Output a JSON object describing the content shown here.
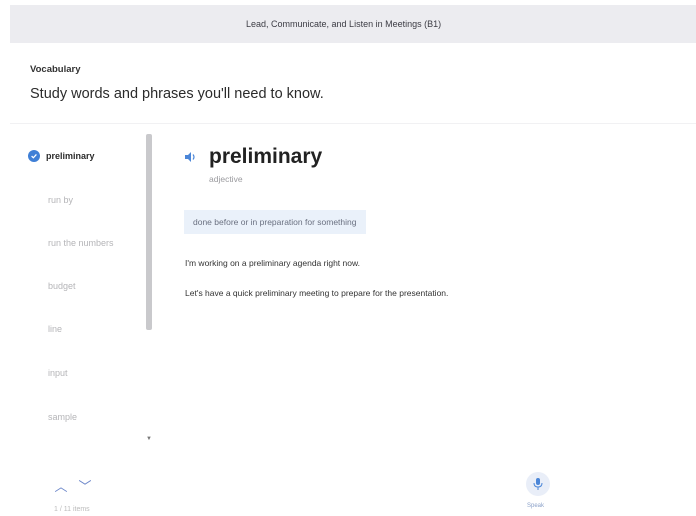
{
  "header": {
    "course_title": "Lead, Communicate, and Listen in Meetings (B1)"
  },
  "section": {
    "label": "Vocabulary",
    "subtitle": "Study words and phrases you'll need to know."
  },
  "word_list": [
    {
      "label": "preliminary",
      "active": true
    },
    {
      "label": "run by"
    },
    {
      "label": "run the numbers"
    },
    {
      "label": "budget"
    },
    {
      "label": "line"
    },
    {
      "label": "input"
    },
    {
      "label": "sample"
    }
  ],
  "nav": {
    "counter": "1 / 11 items"
  },
  "entry": {
    "word": "preliminary",
    "part_of_speech": "adjective",
    "definition": "done before or in preparation for something",
    "examples": [
      "I'm working on a preliminary agenda right now.",
      "Let's have a quick preliminary meeting to prepare for the presentation."
    ]
  },
  "speak": {
    "label": "Speak"
  },
  "colors": {
    "accent": "#3f7fd6",
    "definition_bg": "#eaf1fa",
    "topbar_bg": "#ececf0"
  },
  "icons": [
    "check-circle-icon",
    "speaker-icon",
    "chevron-up-icon",
    "chevron-down-icon",
    "microphone-icon"
  ]
}
